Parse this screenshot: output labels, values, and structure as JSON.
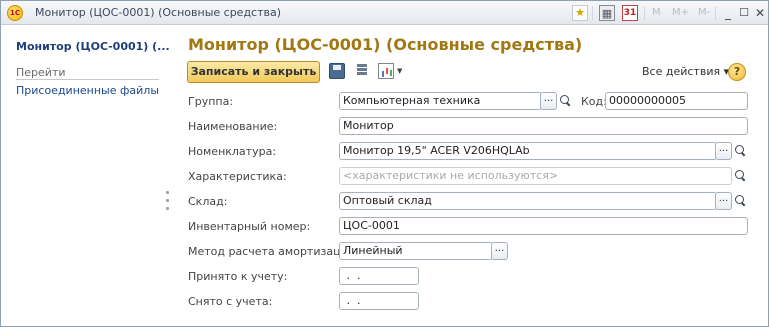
{
  "window": {
    "title": "Монитор (ЦОС-0001) (Основные средства)",
    "logo_text": "1С",
    "m_labels": [
      "M",
      "M+",
      "M-"
    ]
  },
  "left_panel": {
    "title": "Монитор (ЦОС-0001) (...",
    "group_label": "Перейти",
    "links": [
      "Присоединенные файлы"
    ]
  },
  "form": {
    "title": "Монитор (ЦОС-0001) (Основные средства)",
    "save_close_label": "Записать и закрыть",
    "all_actions_label": "Все действия ▾",
    "help_label": "?",
    "fields": {
      "group": {
        "label": "Группа:",
        "value": "Компьютерная техника"
      },
      "code": {
        "label": "Код:",
        "value": "00000000005"
      },
      "name": {
        "label": "Наименование:",
        "value": "Монитор"
      },
      "nomenclature": {
        "label": "Номенклатура:",
        "value": "Монитор 19,5\" ACER V206HQLAb"
      },
      "characteristic": {
        "label": "Характеристика:",
        "placeholder": "<характеристики не используются>"
      },
      "warehouse": {
        "label": "Склад:",
        "value": "Оптовый склад"
      },
      "inventory_number": {
        "label": "Инвентарный номер:",
        "value": "ЦОС-0001"
      },
      "depreciation_method": {
        "label": "Метод расчета амортизации:",
        "value": "Линейный"
      },
      "accepted_date": {
        "label": "Принято к учету:",
        "value": " .  ."
      },
      "removed_date": {
        "label": "Снято с учета:",
        "value": " .  ."
      }
    }
  },
  "icons": {
    "favorite": "star-icon",
    "calculator": "calculator-icon",
    "calendar": "calendar-icon",
    "minimize": "minimize-icon",
    "maximize": "maximize-icon",
    "close": "close-icon",
    "save": "save-icon",
    "list": "list-icon",
    "report": "report-icon",
    "search": "search-icon"
  },
  "colors": {
    "title_accent": "#a17812",
    "button_fill": "#f0c95a",
    "link": "#1c4a8c"
  }
}
